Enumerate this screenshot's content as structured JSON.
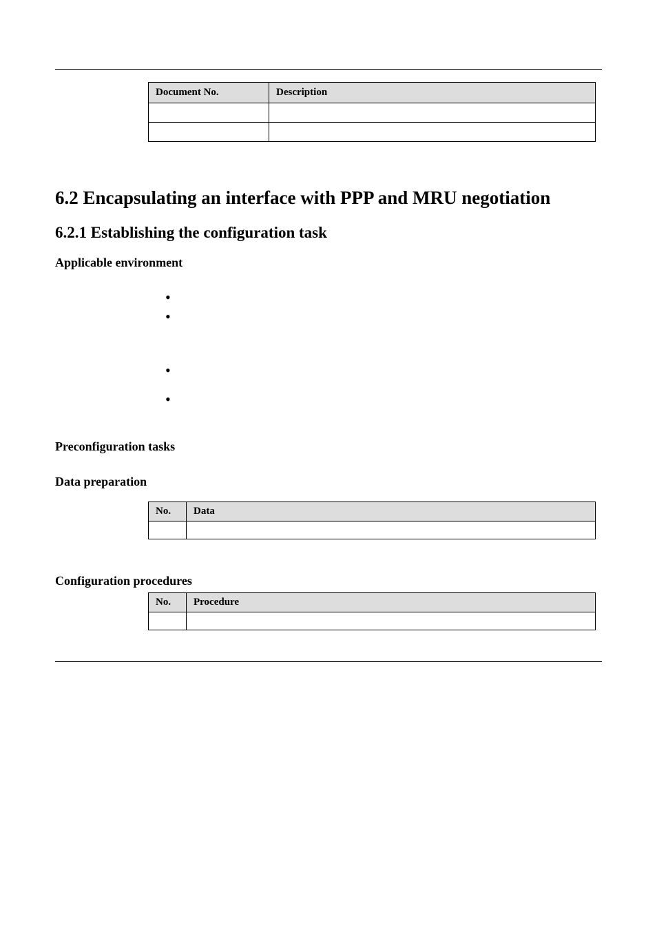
{
  "docTable": {
    "headers": {
      "docNo": "Document No.",
      "description": "Description"
    },
    "rows": [
      {
        "docNo": "",
        "description": ""
      },
      {
        "docNo": "",
        "description": ""
      }
    ]
  },
  "section": {
    "title": "6.2 Encapsulating an interface with PPP and MRU negotiation",
    "subsection": "6.2.1 Establishing the configuration task",
    "applicableEnv": "Applicable environment",
    "bullets": [
      "",
      "",
      "",
      ""
    ],
    "preconfig": "Preconfiguration tasks",
    "dataPrep": "Data preparation",
    "configProc": "Configuration procedures"
  },
  "dataTable": {
    "headers": {
      "no": "No.",
      "data": "Data"
    },
    "rows": [
      {
        "no": "",
        "data": ""
      }
    ]
  },
  "procTable": {
    "headers": {
      "no": "No.",
      "procedure": "Procedure"
    },
    "rows": [
      {
        "no": "",
        "procedure": ""
      }
    ]
  }
}
